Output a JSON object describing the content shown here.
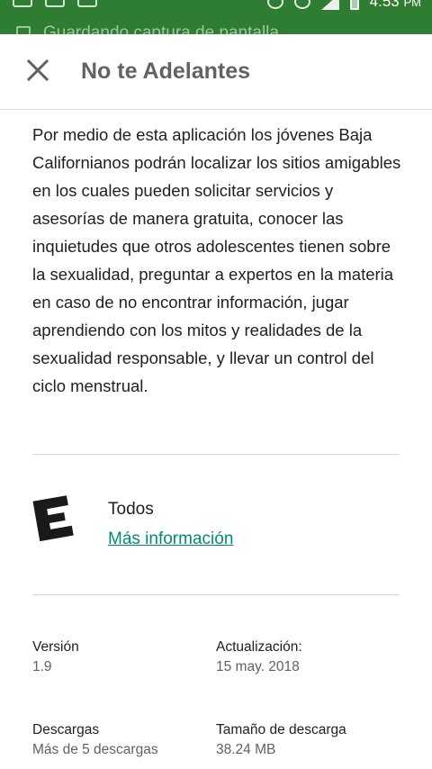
{
  "status_bar": {
    "time": "4:53",
    "ampm": "PM",
    "notification": "Guardando captura de pantalla..."
  },
  "header": {
    "title": "No te Adelantes"
  },
  "description": "Por medio de esta aplicación los jóvenes Baja Californianos podrán localizar los sitios amigables en los cuales pueden solicitar servicios y asesorías de manera gratuita, conocer las inquietudes que otros adolescentes tienen sobre la sexualidad, preguntar a expertos en la materia en caso de no encontrar información, jugar aprendiendo con los mitos y realidades de la sexualidad responsable, y llevar un control del ciclo menstrual.",
  "rating": {
    "icon_letter": "E",
    "label": "Todos",
    "link": "Más información"
  },
  "info": {
    "version_label": "Versión",
    "version_value": "1.9",
    "updated_label": "Actualización:",
    "updated_value": "15 may. 2018",
    "downloads_label": "Descargas",
    "downloads_value": "Más de 5 descargas",
    "size_label": "Tamaño de descarga",
    "size_value": "38.24 MB"
  },
  "colors": {
    "status_bar": "#2e7d32",
    "link": "#00897b",
    "title": "#5f6368"
  }
}
